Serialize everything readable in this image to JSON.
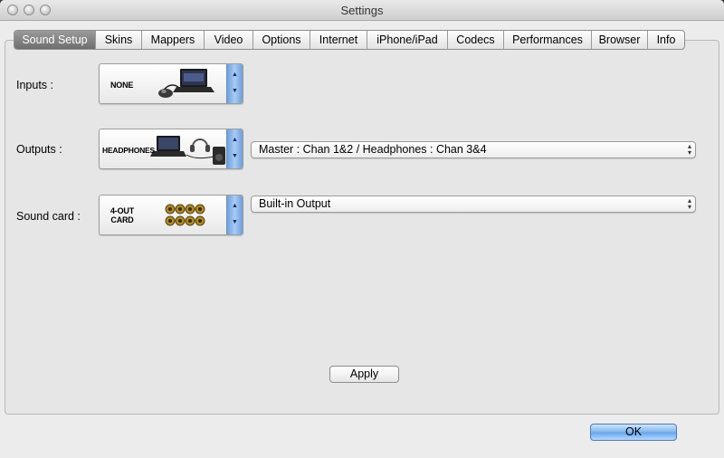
{
  "window": {
    "title": "Settings"
  },
  "tabs": [
    "Sound Setup",
    "Skins",
    "Mappers",
    "Video",
    "Options",
    "Internet",
    "iPhone/iPad",
    "Codecs",
    "Performances",
    "Browser",
    "Info"
  ],
  "active_tab": "Sound Setup",
  "rows": {
    "inputs": {
      "label": "Inputs :",
      "image_text": "NONE"
    },
    "outputs": {
      "label": "Outputs :",
      "image_text": "HEADPHONES",
      "popup_value": "Master : Chan 1&2 / Headphones : Chan 3&4"
    },
    "soundcard": {
      "label": "Sound card :",
      "image_text_line1": "4-OUT",
      "image_text_line2": "CARD",
      "popup_value": "Built-in Output"
    }
  },
  "buttons": {
    "apply": "Apply",
    "ok": "OK"
  },
  "icons": {
    "stepper_up": "▲",
    "stepper_down": "▼",
    "popup_chevron": "up-down-chevron"
  }
}
